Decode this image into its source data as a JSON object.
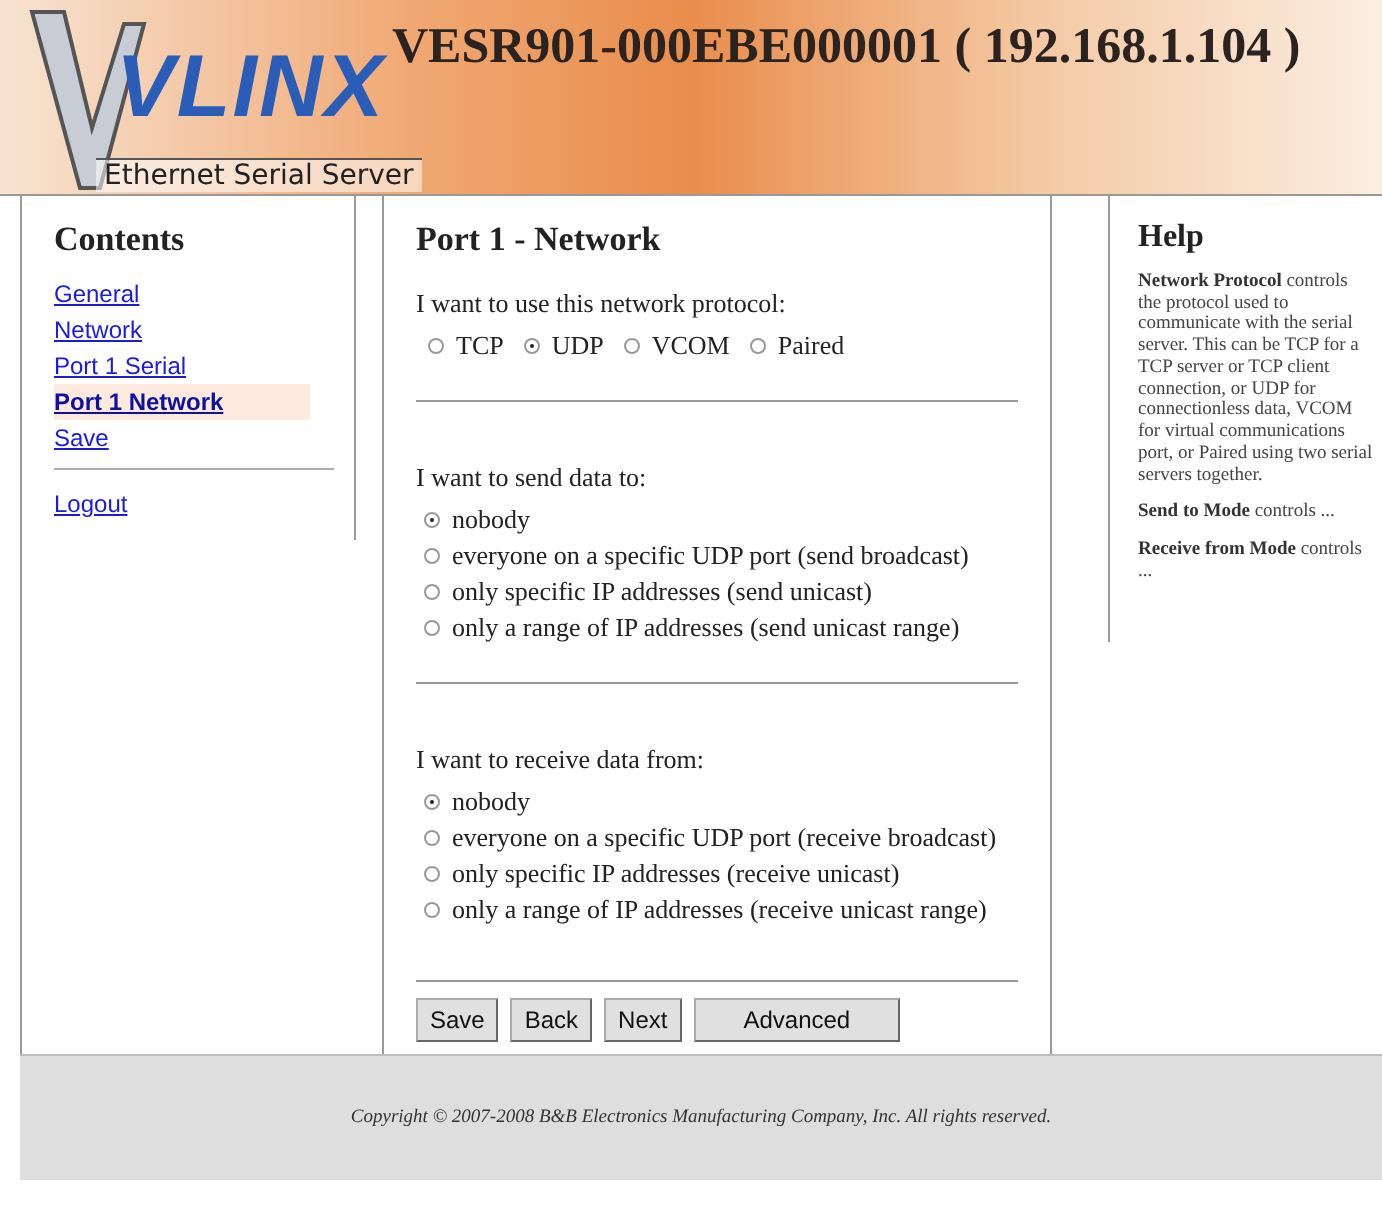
{
  "header": {
    "logo": "VLINX",
    "subtitle": "Ethernet Serial Server",
    "title": "VESR901-000EBE000001 ( 192.168.1.104 )"
  },
  "sidebar": {
    "heading": "Contents",
    "items": [
      {
        "label": "General",
        "selected": false
      },
      {
        "label": "Network",
        "selected": false
      },
      {
        "label": "Port 1 Serial",
        "selected": false
      },
      {
        "label": "Port 1 Network",
        "selected": true
      },
      {
        "label": "Save",
        "selected": false
      }
    ],
    "logout": "Logout"
  },
  "main": {
    "heading": "Port 1 - Network",
    "groups": [
      {
        "prompt": "I want to use this network protocol:",
        "kind": "inline",
        "options": [
          {
            "label": "TCP",
            "selected": false
          },
          {
            "label": "UDP",
            "selected": true
          },
          {
            "label": "VCOM",
            "selected": false
          },
          {
            "label": "Paired",
            "selected": false
          }
        ]
      },
      {
        "prompt": "I want to send data to:",
        "kind": "stacked",
        "options": [
          {
            "label": "nobody",
            "selected": true
          },
          {
            "label": "everyone on a specific UDP port (send broadcast)",
            "selected": false
          },
          {
            "label": "only specific IP addresses (send unicast)",
            "selected": false
          },
          {
            "label": "only a range of IP addresses (send unicast range)",
            "selected": false
          }
        ]
      },
      {
        "prompt": "I want to receive data from:",
        "kind": "stacked",
        "options": [
          {
            "label": "nobody",
            "selected": true
          },
          {
            "label": "everyone on a specific UDP port (receive broadcast)",
            "selected": false
          },
          {
            "label": "only specific IP addresses (receive unicast)",
            "selected": false
          },
          {
            "label": "only a range of IP addresses (receive unicast range)",
            "selected": false
          }
        ]
      }
    ],
    "buttons": [
      "Save",
      "Back",
      "Next",
      "Advanced"
    ]
  },
  "help": {
    "heading": "Help",
    "paragraphs": [
      "**Network Protocol** controls the protocol used to communicate with the serial server. This can be TCP for a TCP server or TCP client connection, or UDP for connectionless data, VCOM for virtual communications port, or Paired using two serial servers together.",
      "**Send to Mode** controls ...",
      "**Receive from Mode** controls ..."
    ]
  },
  "footer": {
    "copyright": "Copyright © 2007-2008 B&B Electronics Manufacturing Company, Inc. All rights reserved."
  }
}
